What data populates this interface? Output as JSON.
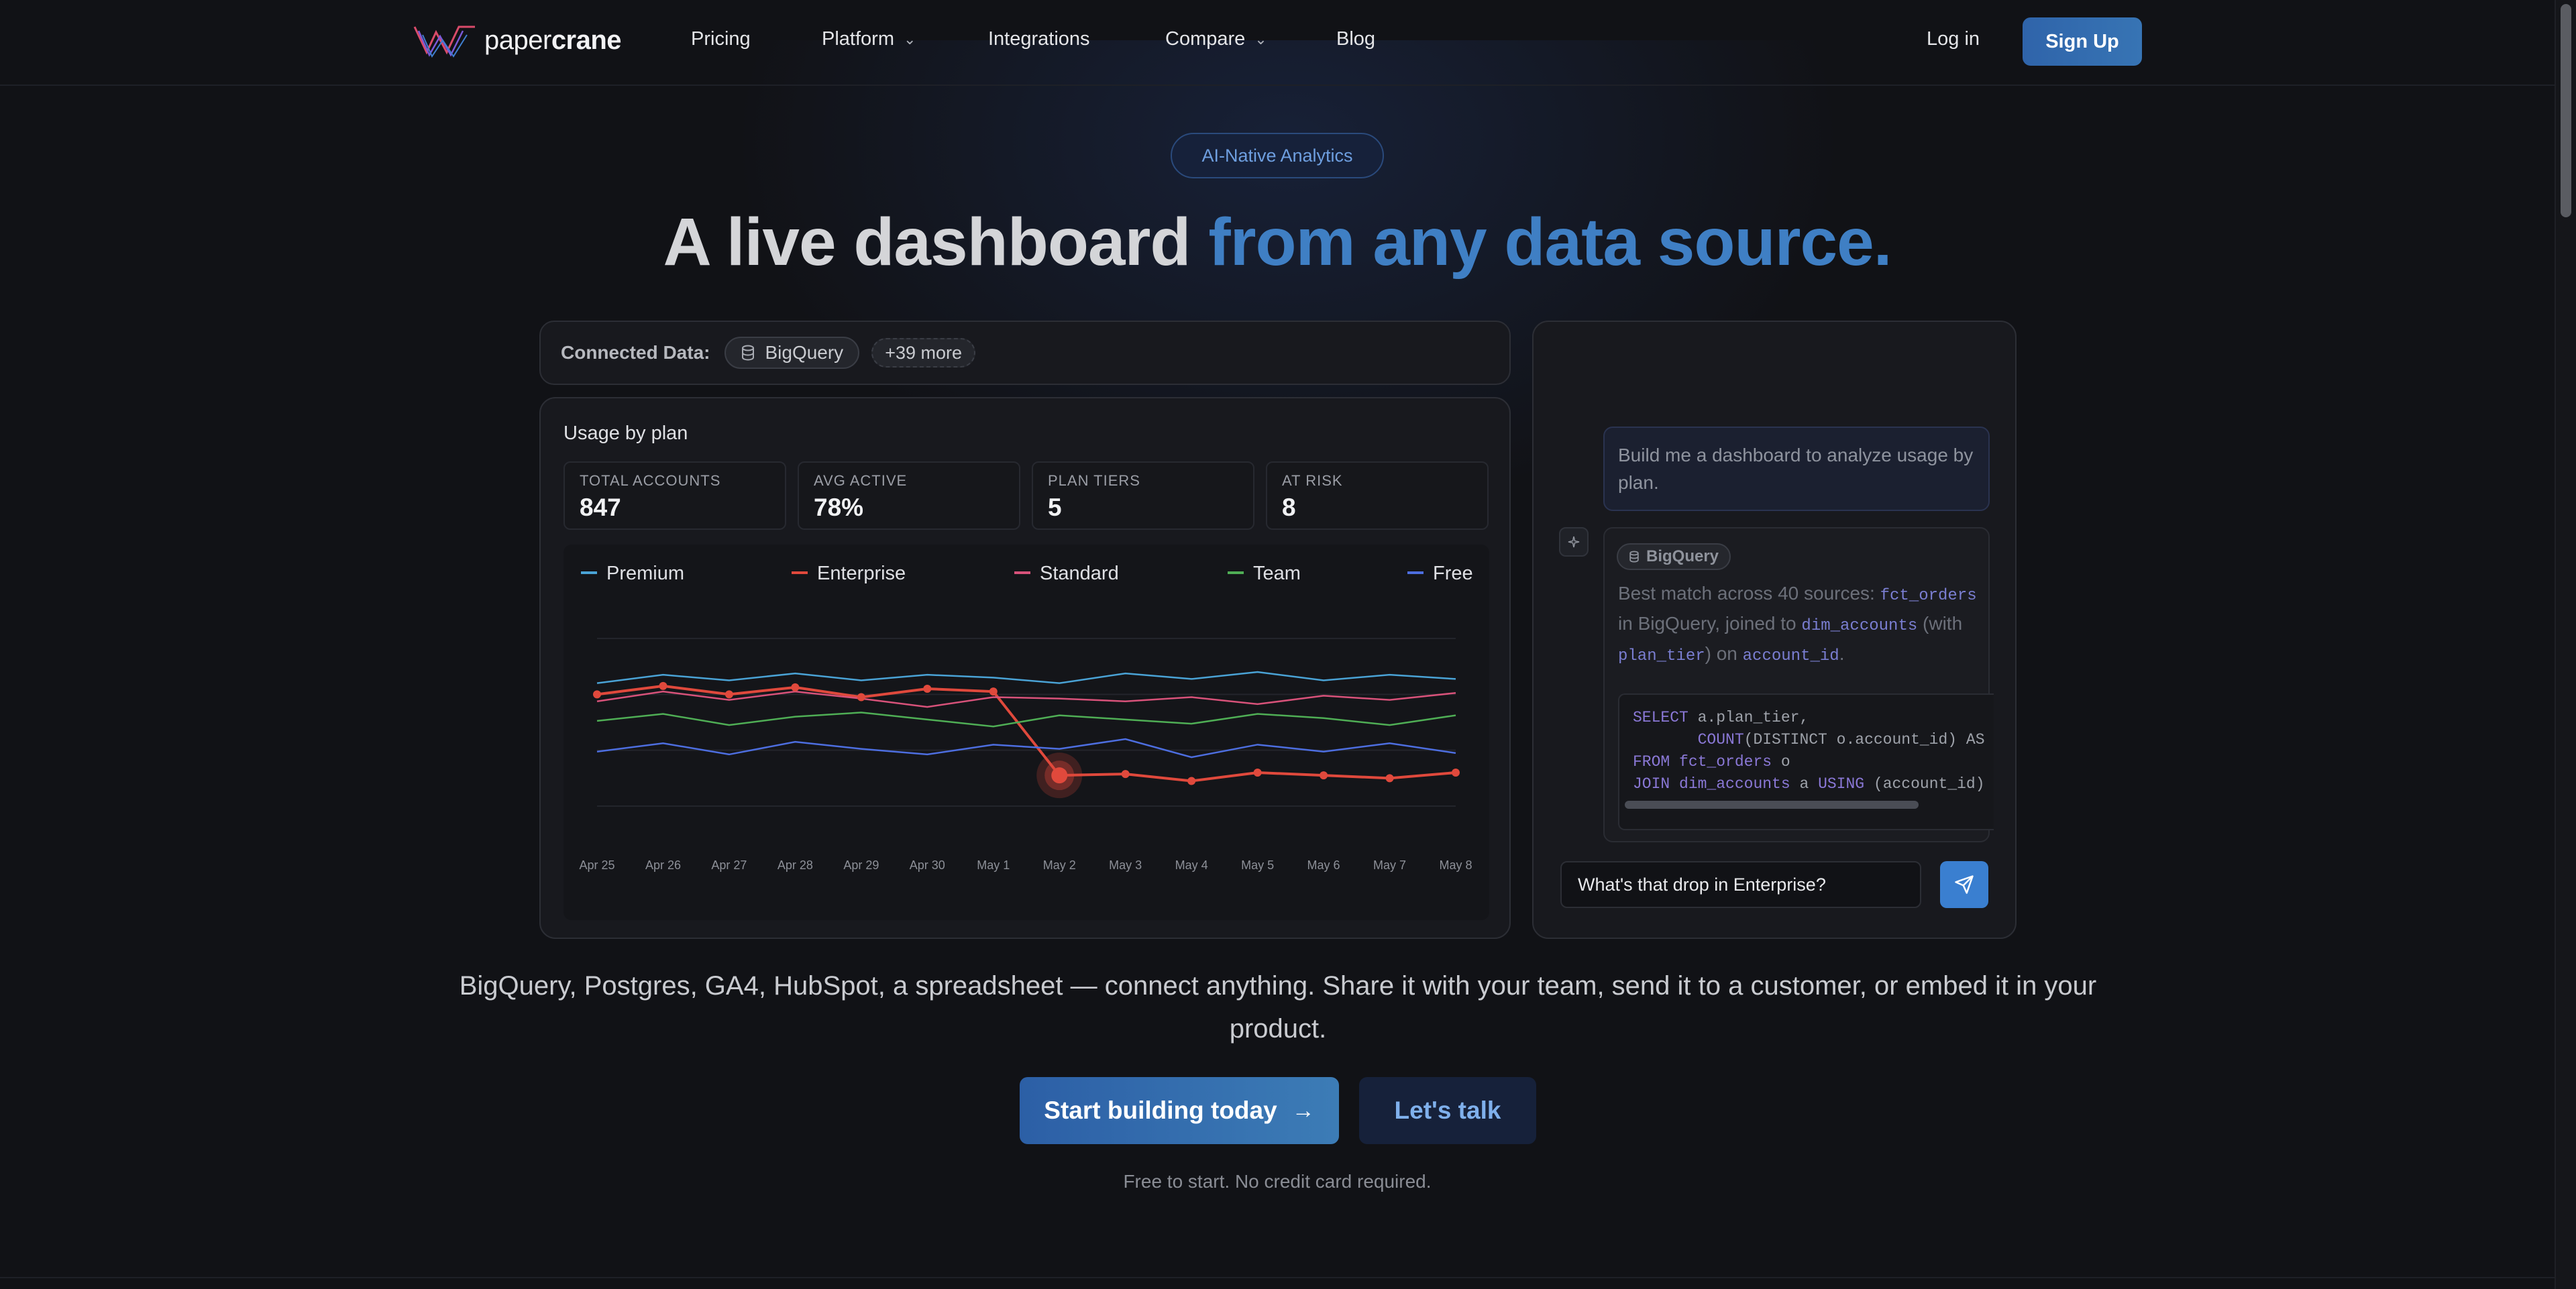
{
  "nav": {
    "logo_part1": "paper",
    "logo_part2": "crane",
    "links": [
      {
        "label": "Pricing"
      },
      {
        "label": "Platform"
      },
      {
        "label": "Integrations"
      },
      {
        "label": "Compare"
      },
      {
        "label": "Blog"
      }
    ],
    "login": "Log in",
    "signup": "Sign Up"
  },
  "hero": {
    "badge": "AI-Native Analytics",
    "headline_part1": "A live dashboard ",
    "headline_part2": "from any data source."
  },
  "connected": {
    "label": "Connected Data:",
    "source": "BigQuery",
    "more": "+39 more"
  },
  "dashboard": {
    "title": "Usage by plan",
    "kpis": [
      {
        "label": "TOTAL ACCOUNTS",
        "value": "847"
      },
      {
        "label": "AVG ACTIVE",
        "value": "78%"
      },
      {
        "label": "PLAN TIERS",
        "value": "5"
      },
      {
        "label": "AT RISK",
        "value": "8"
      }
    ]
  },
  "chart_data": {
    "type": "line",
    "categories": [
      "Apr 25",
      "Apr 26",
      "Apr 27",
      "Apr 28",
      "Apr 29",
      "Apr 30",
      "May 1",
      "May 2",
      "May 3",
      "May 4",
      "May 5",
      "May 6",
      "May 7",
      "May 8"
    ],
    "series": [
      {
        "name": "Premium",
        "color": "#4aa3d6",
        "values": [
          88,
          94,
          90,
          95,
          90,
          94,
          92,
          88,
          95,
          91,
          96,
          90,
          94,
          91
        ]
      },
      {
        "name": "Enterprise",
        "color": "#e0493c",
        "values": [
          80,
          86,
          80,
          85,
          78,
          84,
          82,
          22,
          23,
          18,
          24,
          22,
          20,
          24
        ],
        "markers": true,
        "highlight_index": 7
      },
      {
        "name": "Standard",
        "color": "#d8527a",
        "values": [
          75,
          82,
          76,
          82,
          77,
          71,
          78,
          77,
          75,
          78,
          73,
          79,
          76,
          81
        ]
      },
      {
        "name": "Team",
        "color": "#4fae55",
        "values": [
          61,
          66,
          58,
          64,
          67,
          62,
          57,
          65,
          62,
          59,
          66,
          63,
          58,
          65
        ]
      },
      {
        "name": "Free",
        "color": "#4d6ee0",
        "values": [
          39,
          45,
          37,
          46,
          41,
          37,
          44,
          41,
          48,
          35,
          44,
          39,
          45,
          38
        ]
      }
    ],
    "ylim": [
      0,
      120
    ]
  },
  "chat": {
    "user_message": "Build me a dashboard to analyze usage by plan.",
    "ai_source": "BigQuery",
    "ai_text_1": "Best match across 40 sources: ",
    "ai_code_1": "fct_orders",
    "ai_text_2": " in BigQuery, joined to ",
    "ai_code_2": "dim_accounts",
    "ai_text_3": " (with ",
    "ai_code_3": "plan_tier",
    "ai_text_4": ") on ",
    "ai_code_4": "account_id",
    "ai_text_5": ".",
    "sql": [
      {
        "kw": "SELECT",
        "rest": " a.plan_tier,"
      },
      {
        "kw": "       COUNT",
        "rest": "(DISTINCT o.account_id) AS a"
      },
      {
        "kw": "FROM",
        "tb": " fct_orders",
        "rest": " o"
      },
      {
        "kw": "JOIN",
        "tb": " dim_accounts",
        "rest": " a ",
        "kw2": "USING",
        "rest2": " (account_id)"
      }
    ],
    "input_value": "What's that drop in Enterprise?"
  },
  "below": {
    "subtext": "BigQuery, Postgres, GA4, HubSpot, a spreadsheet — connect anything. Share it with your team, send it to a customer, or embed it in your product.",
    "cta_primary": "Start building today",
    "cta_secondary": "Let's talk",
    "fineprint": "Free to start. No credit card required."
  }
}
